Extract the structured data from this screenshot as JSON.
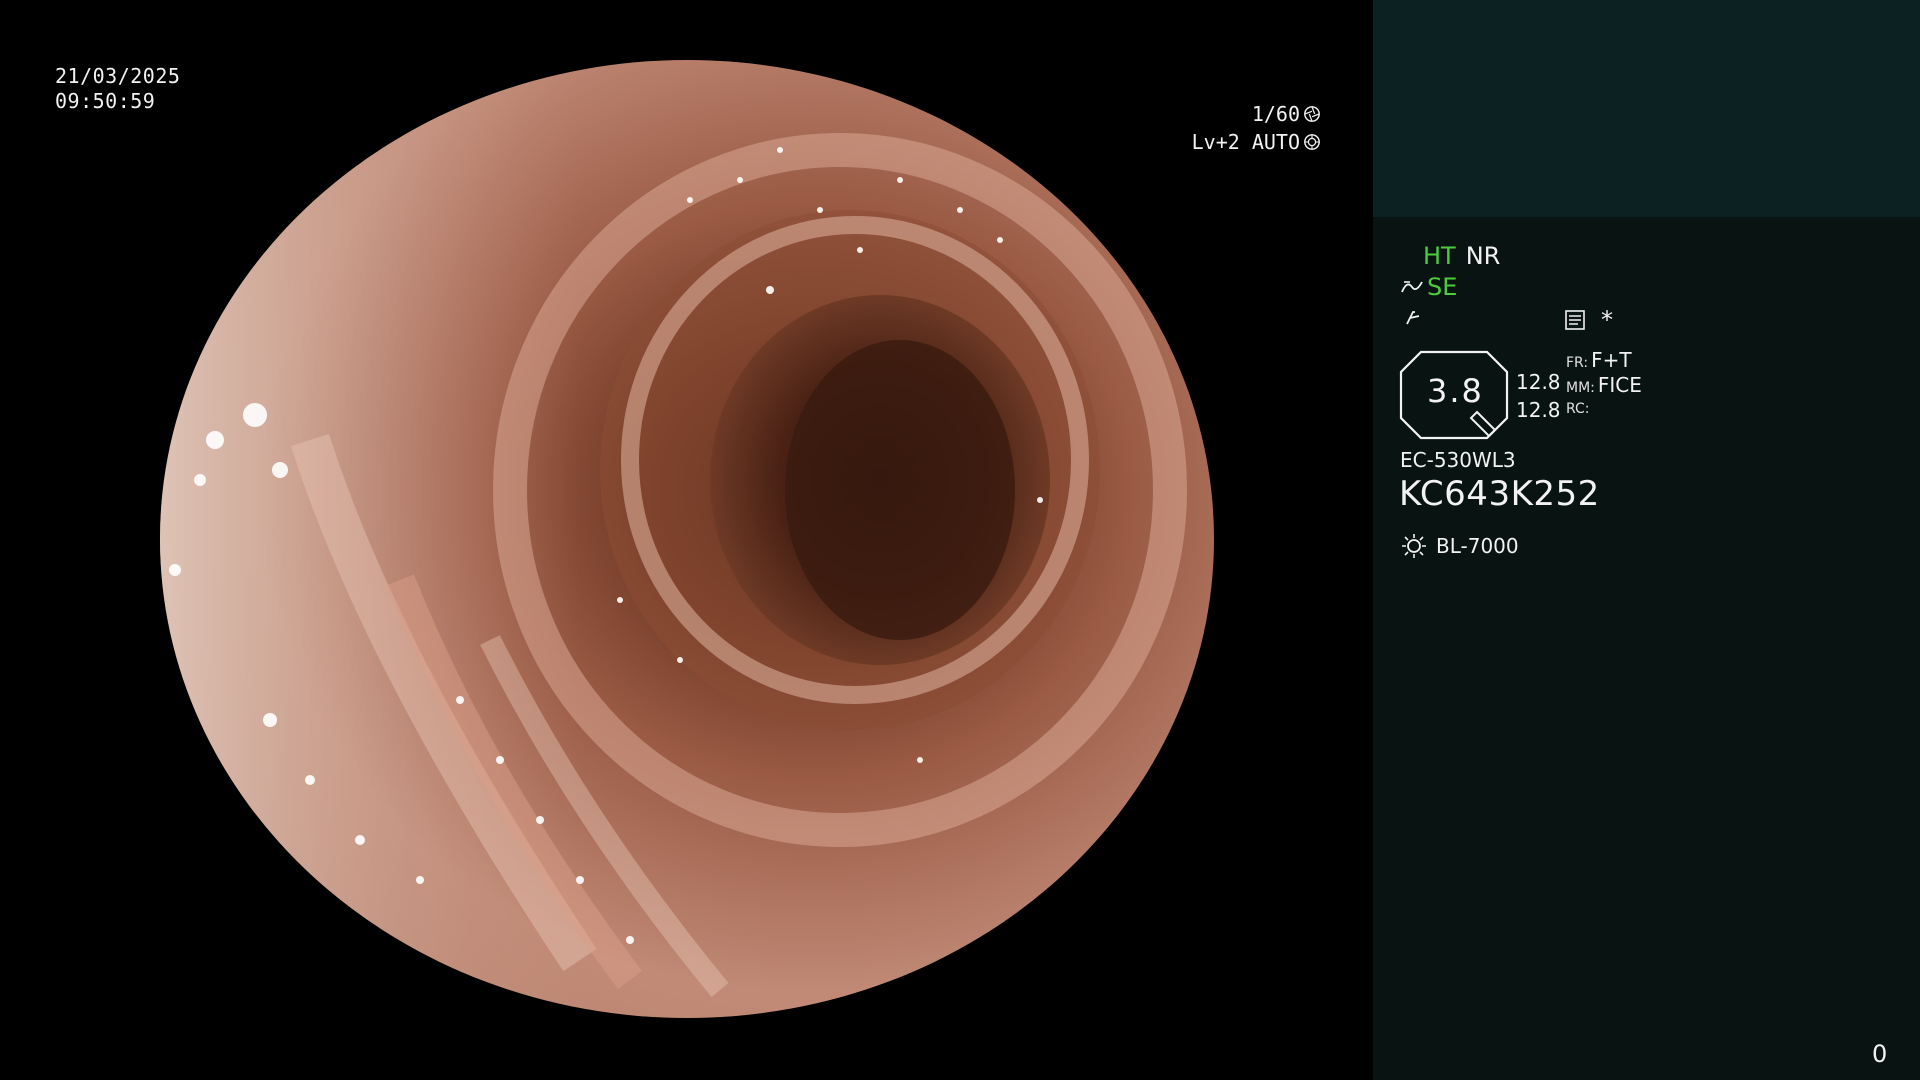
{
  "overlay": {
    "date": "21/03/2025",
    "time": "09:50:59",
    "shutter": "1/60",
    "shutter_icon": "aperture-icon",
    "level": "Lv+2 AUTO",
    "level_icon": "auto-iris-icon"
  },
  "panel": {
    "mode_ht": "HT",
    "mode_nr": "NR",
    "mode_se": "SE",
    "mode_se_icon": "enhance-curve-icon",
    "mode_f_icon": "freeze-icon",
    "memo_icon": "memo-icon",
    "asterisk": "*",
    "zoom_value": "3.8",
    "fr_label": "FR:",
    "fr_value": "F+T",
    "mm_label": "MM:",
    "mm_value": "FICE",
    "rc_label": "RC:",
    "rc_value": "",
    "val_1": "12.8",
    "val_2": "12.8",
    "scope_model": "EC-530WL3",
    "serial": "KC643K252",
    "lamp_icon": "light-source-icon",
    "lamp_model": "BL-7000",
    "counter": "0"
  },
  "colors": {
    "panel_bg": "#081312",
    "panel_top_bg": "#0c2222",
    "accent_green": "#4ccd3c"
  }
}
